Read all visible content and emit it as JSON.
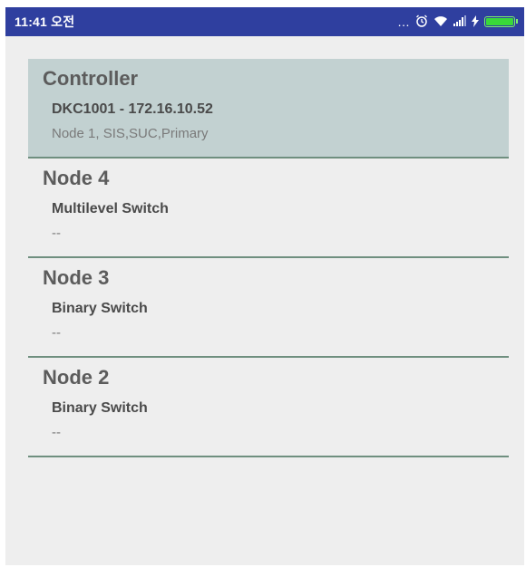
{
  "status_bar": {
    "time": "11:41 오전",
    "icons": [
      "more-dots-icon",
      "alarm-icon",
      "wifi-icon",
      "signal-icon",
      "charging-icon",
      "battery-icon"
    ],
    "battery_level": 1.0,
    "accent": "#2f3f9f"
  },
  "nodes": [
    {
      "title": "Controller",
      "type": "DKC1001 - 172.16.10.52",
      "detail": "Node 1, SIS,SUC,Primary",
      "selected": true
    },
    {
      "title": "Node 4",
      "type": "Multilevel Switch",
      "detail": "--",
      "selected": false
    },
    {
      "title": "Node 3",
      "type": "Binary Switch",
      "detail": "--",
      "selected": false
    },
    {
      "title": "Node 2",
      "type": "Binary Switch",
      "detail": "--",
      "selected": false
    }
  ],
  "colors": {
    "selected_bg": "#c2d1d1",
    "divider": "#6f8f7f",
    "background": "#eeeeee"
  }
}
